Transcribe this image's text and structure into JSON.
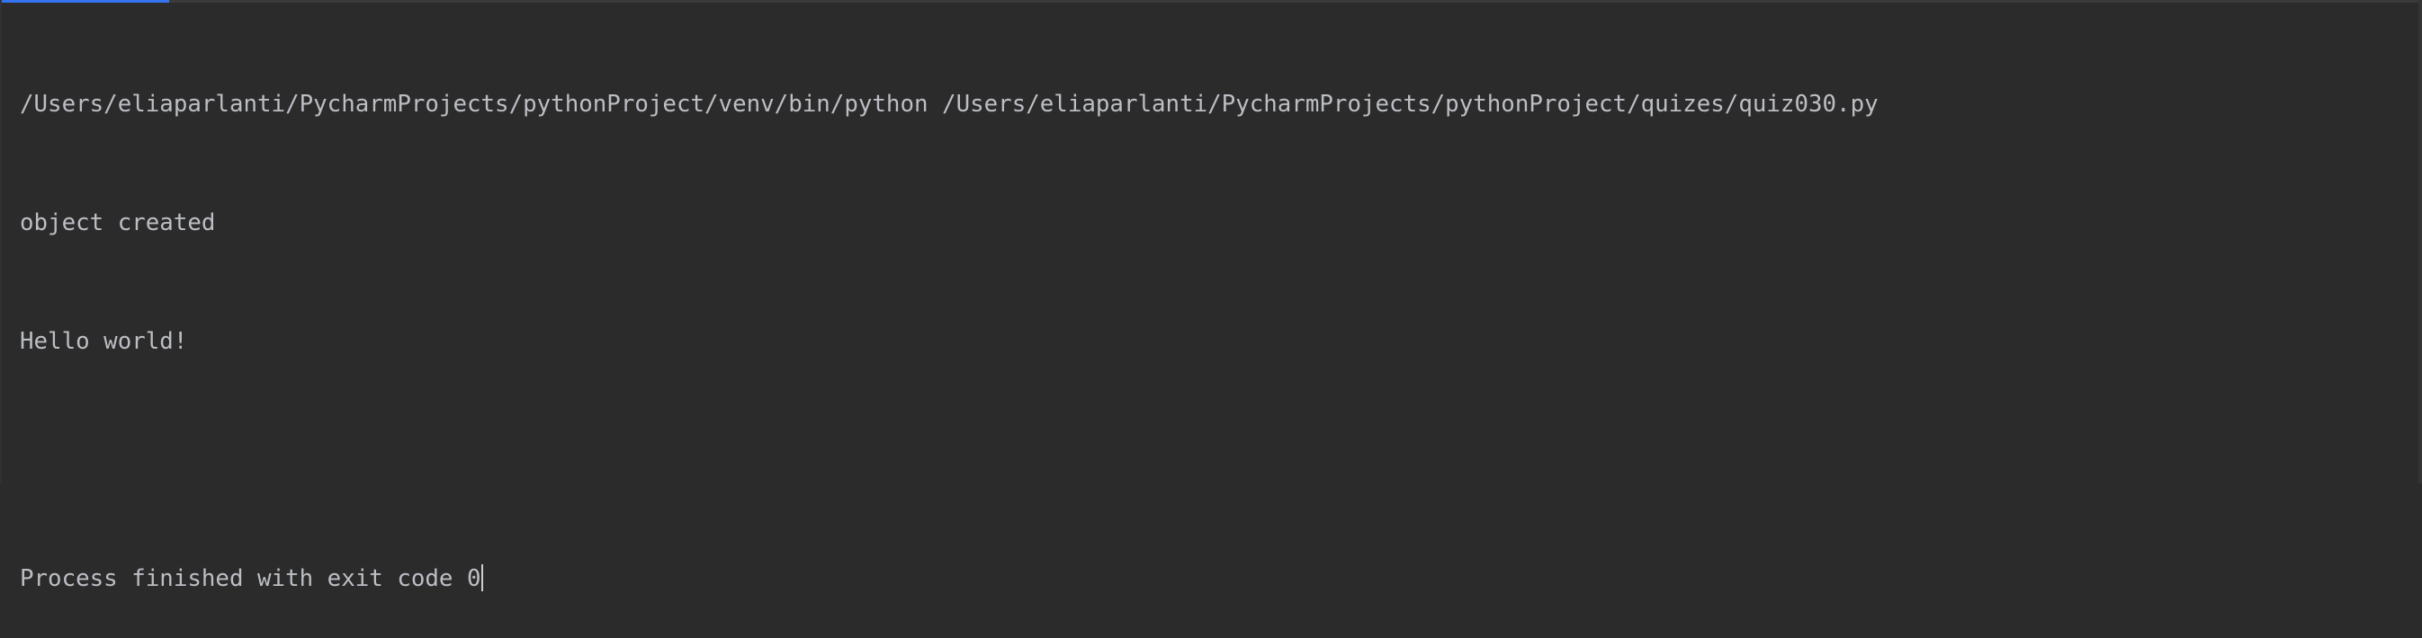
{
  "console": {
    "lines": [
      "/Users/eliaparlanti/PycharmProjects/pythonProject/venv/bin/python /Users/eliaparlanti/PycharmProjects/pythonProject/quizes/quiz030.py",
      "object created",
      "Hello world!",
      "",
      "Process finished with exit code 0"
    ]
  },
  "colors": {
    "background": "#2b2b2b",
    "text": "#bcbec4",
    "accent": "#3574f0"
  }
}
